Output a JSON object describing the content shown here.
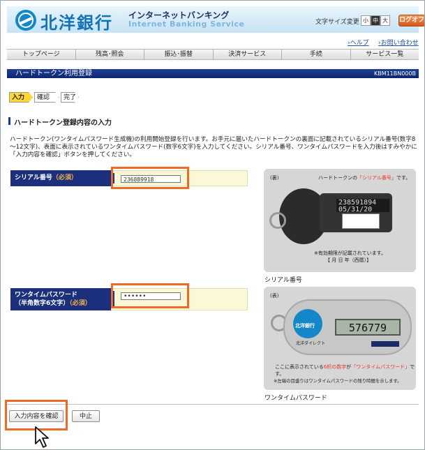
{
  "header": {
    "bank_name": "北洋銀行",
    "service_jp": "インターネットバンキング",
    "service_en": "Internet Banking Service",
    "font_size_label": "文字サイズ変更",
    "font_sizes": [
      "小",
      "中",
      "大"
    ],
    "font_size_selected": "中",
    "logout": "ログオフ"
  },
  "links": {
    "help": "ヘルプ",
    "contact": "お問い合わせ"
  },
  "nav": [
    "トップページ",
    "残高･照会",
    "振込･振替",
    "決済サービス",
    "手続",
    "サービス一覧"
  ],
  "page": {
    "title": "ハードトークン利用登録",
    "screen_code": "KBM11BN000B"
  },
  "steps": [
    "入力",
    "確認",
    "完了"
  ],
  "section_title": "ハードトークン登録内容の入力",
  "description": "ハードトークン(ワンタイムパスワード生成機)の利用開始登録を行います。お手元に届いたハードトークンの裏面に記載されているシリアル番号(数字8～12文字)、表面に表示されているワンタイムパスワード(数字6文字)を入力してください。シリアル番号、ワンタイムパスワードを入力後はすみやかに「入力内容を確認」ボタンを押してください。",
  "form": {
    "serial_label": "シリアル番号",
    "otp_label_line1": "ワンタイムパスワード",
    "otp_label_line2": "（半角数字6文字）",
    "required": "（必須）",
    "serial_value": "236889918",
    "otp_value": "••••••"
  },
  "images": {
    "back": {
      "side": "(裏)",
      "callout_pre": "ハードトークンの",
      "callout_hl": "「シリアル番号」",
      "callout_post": "です。",
      "serial_on_device": "238591894",
      "date_on_device": "05/31/20",
      "note1": "※有効期限が記載されています。",
      "note2": "【 月 日 年（西暦）】",
      "caption": "シリアル番号"
    },
    "front": {
      "side": "(表)",
      "device_bank": "北洋銀行",
      "device_sub": "北洋ダイレクト",
      "display_number": "576779",
      "note_pre": "ここに表示されている",
      "note_hl1": "6桁の数字",
      "note_mid": "が",
      "note_hl2": "「ワンタイムパスワード」",
      "note_post": "です。",
      "note2": "※左端の目盛りはワンタイムパスワードの残り時間を示します。",
      "caption": "ワンタイムパスワード"
    }
  },
  "buttons": {
    "confirm": "入力内容を確認",
    "cancel": "中止"
  },
  "colors": {
    "accent": "#ee6b25",
    "navy": "#1b2f7d",
    "brand_blue": "#1487c9"
  }
}
